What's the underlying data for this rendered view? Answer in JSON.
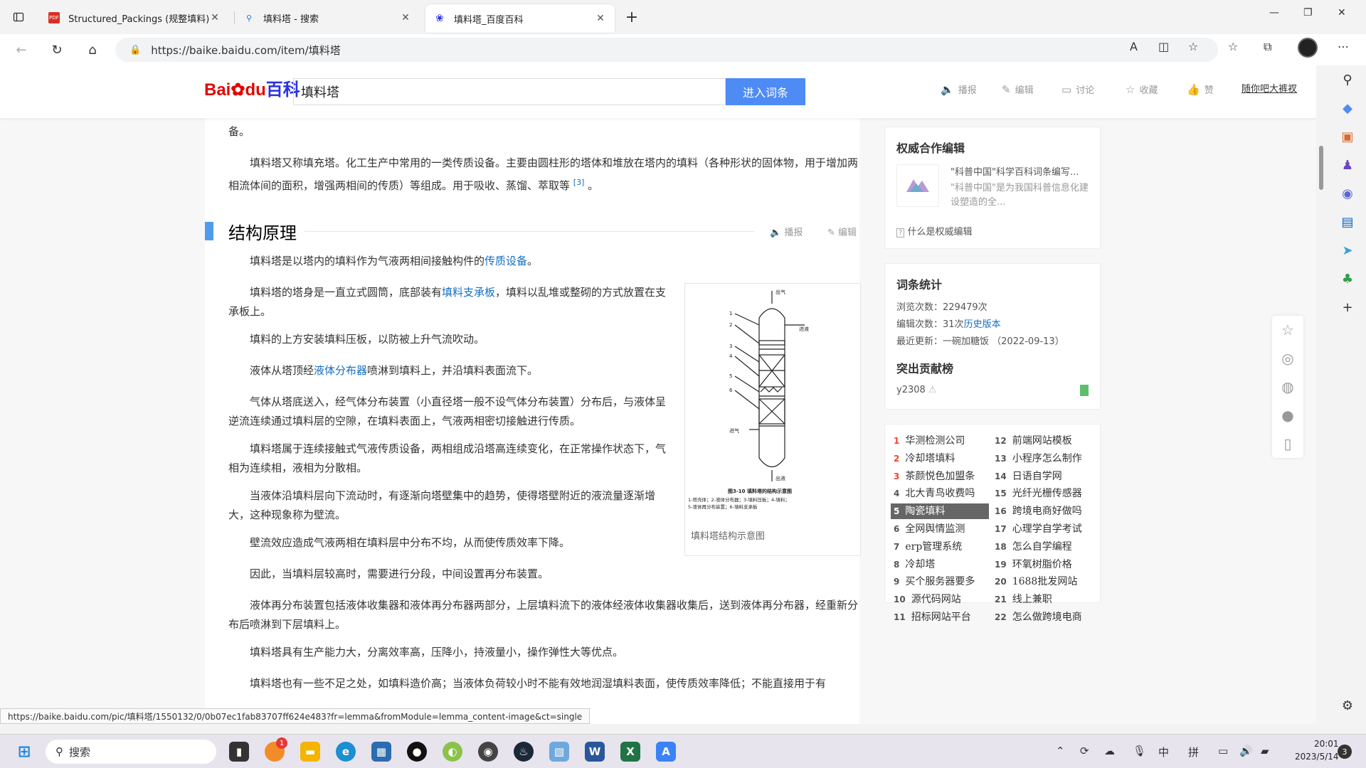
{
  "browser": {
    "tabs": [
      {
        "title": "Structured_Packings (规整填料)",
        "icon": "pdf-icon"
      },
      {
        "title": "填料塔 - 搜索",
        "icon": "search-icon"
      },
      {
        "title": "填料塔_百度百科",
        "icon": "baidu-paw-icon"
      }
    ],
    "new_tab": "+",
    "url": "https://baike.baidu.com/item/填料塔"
  },
  "baike": {
    "logo_bai": "Bai",
    "logo_du": "du",
    "logo_baike": "百科",
    "search_value": "填料塔",
    "search_button": "进入词条",
    "actions": {
      "broadcast": "播报",
      "edit": "编辑",
      "discuss": "讨论",
      "favorite": "收藏",
      "like": "赞"
    },
    "promo_link": "随你吧大裤衩"
  },
  "article": {
    "p0_tail": "备。",
    "p1": "填料塔又称填充塔。化工生产中常用的一类传质设备。主要由圆柱形的塔体和堆放在塔内的填料（各种形状的固体物，用于增加两相流体间的面积，增强两相间的传质）等组成。用于吸收、蒸馏、萃取等",
    "p1_ref": "[3]",
    "p1_end": "。",
    "section_title": "结构原理",
    "section_broadcast": "播报",
    "section_edit": "编辑",
    "p2a": "填料塔是以塔内的填料作为气液两相间接触构件的",
    "p2_link": "传质设备",
    "p2b": "。",
    "p3a": "填料塔的塔身是一直立式圆筒，底部装有",
    "p3_link": "填料支承板",
    "p3b": "，填料以乱堆或整砌的方式放置在支承板上。",
    "p4": "填料的上方安装填料压板，以防被上升气流吹动。",
    "p5a": "液体从塔顶经",
    "p5_link": "液体分布器",
    "p5b": "喷淋到填料上，并沿填料表面流下。",
    "p6": "气体从塔底送入，经气体分布装置（小直径塔一般不设气体分布装置）分布后，与液体呈逆流连续通过填料层的空隙，在填料表面上，气液两相密切接触进行传质。",
    "p7": "填料塔属于连续接触式气液传质设备，两相组成沿塔高连续变化，在正常操作状态下，气相为连续相，液相为分散相。",
    "p8": "当液体沿填料层向下流动时，有逐渐向塔壁集中的趋势，使得塔壁附近的液流量逐渐增大，这种现象称为壁流。",
    "p9": "壁流效应造成气液两相在填料层中分布不均，从而使传质效率下降。",
    "p10": "因此，当填料层较高时，需要进行分段，中间设置再分布装置。",
    "p11": "液体再分布装置包括液体收集器和液体再分布器两部分，上层填料流下的液体经液体收集器收集后，送到液体再分布器，经重新分布后喷淋到下层填料上。",
    "p12": "填料塔具有生产能力大，分离效率高，压降小，持液量小，操作弹性大等优点。",
    "p13": "填料塔也有一些不足之处，如填料造价高；当液体负荷较小时不能有效地润湿填料表面，使传质效率降低；不能直接用于有",
    "figure_caption": "填料塔结构示意图",
    "figure_labels": {
      "top": "出气",
      "feed": "进液",
      "gas_in": "进气",
      "bottom": "出液",
      "title": "图3-10 填料塔的结构示意图",
      "legend1": "1-塔壳体；2-液体分布器；3-填料压板；4-填料；",
      "legend2": "5-液体再分布装置；6-填料支承板",
      "n1": "1",
      "n2": "2",
      "n3": "3",
      "n4": "4",
      "n5": "5",
      "n6": "6"
    }
  },
  "sidebar": {
    "authority_title": "权威合作编辑",
    "authority_name": "\"科普中国\"科学百科词条编写...",
    "authority_desc": "\"科普中国\"是为我国科普信息化建设塑造的全...",
    "authority_help": "什么是权威编辑",
    "stats_title": "词条统计",
    "views_label": "浏览次数：",
    "views": "229479次",
    "edits_label": "编辑次数：",
    "edits": "31次",
    "history": "历史版本",
    "updated_label": "最近更新：",
    "updated": "一碗加糖饭 （2022-09-13）",
    "contrib_title": "突出贡献榜",
    "contrib_user": "y2308",
    "hot_left": [
      {
        "n": "1",
        "t": "华测检测公司"
      },
      {
        "n": "2",
        "t": "冷却塔填料"
      },
      {
        "n": "3",
        "t": "茶颜悦色加盟条"
      },
      {
        "n": "4",
        "t": "北大青鸟收费吗"
      },
      {
        "n": "5",
        "t": "陶瓷填料"
      },
      {
        "n": "6",
        "t": "全网舆情监测"
      },
      {
        "n": "7",
        "t": "erp管理系统"
      },
      {
        "n": "8",
        "t": "冷却塔"
      },
      {
        "n": "9",
        "t": "买个服务器要多"
      },
      {
        "n": "10",
        "t": "源代码网站"
      },
      {
        "n": "11",
        "t": "招标网站平台"
      }
    ],
    "hot_right": [
      {
        "n": "12",
        "t": "前端网站模板"
      },
      {
        "n": "13",
        "t": "小程序怎么制作"
      },
      {
        "n": "14",
        "t": "日语自学网"
      },
      {
        "n": "15",
        "t": "光纤光栅传感器"
      },
      {
        "n": "16",
        "t": "跨境电商好做吗"
      },
      {
        "n": "17",
        "t": "心理学自学考试"
      },
      {
        "n": "18",
        "t": "怎么自学编程"
      },
      {
        "n": "19",
        "t": "环氧树脂价格"
      },
      {
        "n": "20",
        "t": "1688批发网站"
      },
      {
        "n": "21",
        "t": "线上兼职"
      },
      {
        "n": "22",
        "t": "怎么做跨境电商"
      }
    ]
  },
  "status_bar_url": "https://baike.baidu.com/pic/填料塔/1550132/0/0b07ec1fab83707ff624e483?fr=lemma&fromModule=lemma_content-image&ct=single",
  "taskbar": {
    "search_placeholder": "搜索",
    "badge_count": "1",
    "ime_lang": "中",
    "ime_mode": "拼",
    "time": "20:01",
    "date": "2023/5/14",
    "notif_count": "3"
  },
  "colors": {
    "accent": "#4e8bf4",
    "link": "#136ec2",
    "section_bar": "#4f9cee",
    "hot_rank": "#ee4433"
  }
}
